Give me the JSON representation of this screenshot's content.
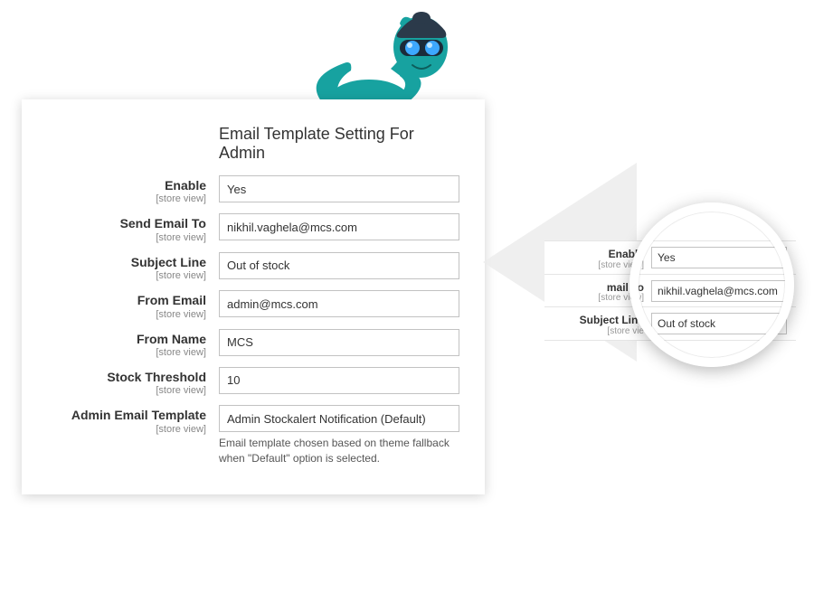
{
  "heading": "Email Template Setting For Admin",
  "scope_text": "[store view]",
  "fields": {
    "enable": {
      "label": "Enable",
      "value": "Yes"
    },
    "send_to": {
      "label": "Send Email To",
      "value": "nikhil.vaghela@mcs.com"
    },
    "subject": {
      "label": "Subject Line",
      "value": "Out of stock"
    },
    "from_email": {
      "label": "From Email",
      "value": "admin@mcs.com"
    },
    "from_name": {
      "label": "From Name",
      "value": "MCS"
    },
    "threshold": {
      "label": "Stock Threshold",
      "value": "10"
    },
    "template": {
      "label": "Admin Email Template",
      "value": "Admin Stockalert Notification (Default)"
    }
  },
  "template_hint": "Email template chosen based on theme fallback when \"Default\" option is selected.",
  "zoom": {
    "enable": {
      "label": "Enable",
      "value": "Yes"
    },
    "send_to": {
      "label": "mail To",
      "value": "nikhil.vaghela@mcs.com"
    },
    "subject": {
      "label": "Subject Line",
      "value": "Out of stock"
    },
    "scope_partial_a": "[store view]",
    "scope_partial_b": "[store view]",
    "scope_partial_c": "[store vie"
  }
}
